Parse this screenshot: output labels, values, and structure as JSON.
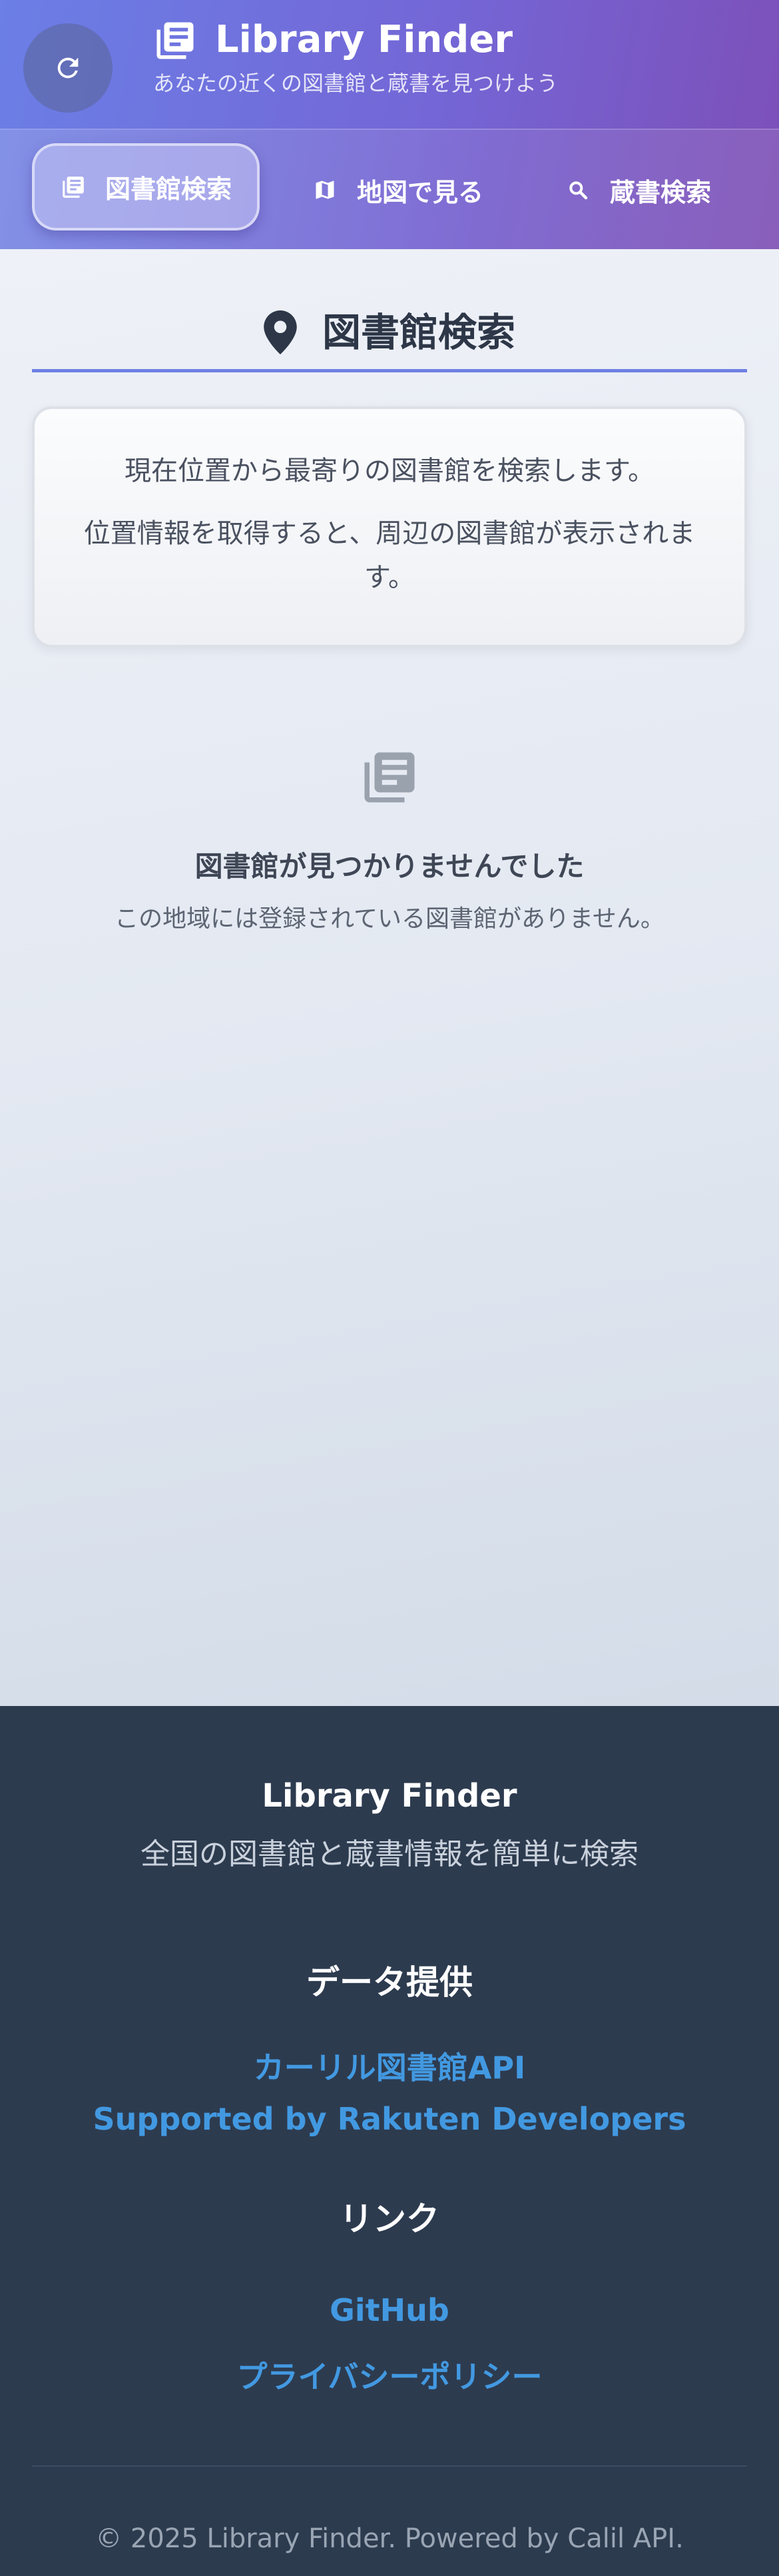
{
  "header": {
    "title": "Library Finder",
    "subtitle": "あなたの近くの図書館と蔵書を見つけよう",
    "refresh_icon": "refresh-icon",
    "brand_icon": "library-books-icon",
    "gradient_colors": [
      "#6b7fe6",
      "#7466d6",
      "#7d4fb8"
    ]
  },
  "nav": {
    "tabs": [
      {
        "label": "図書館検索",
        "icon": "library-books-icon",
        "active": true
      },
      {
        "label": "地図で見る",
        "icon": "map-icon",
        "active": false
      },
      {
        "label": "蔵書検索",
        "icon": "search-icon",
        "active": false
      }
    ]
  },
  "main": {
    "section_title": "図書館検索",
    "section_icon": "location-pin-icon",
    "accent_color": "#6f80e4",
    "info": {
      "line1": "現在位置から最寄りの図書館を検索します。",
      "line2": "位置情報を取得すると、周辺の図書館が表示されます。"
    },
    "empty_state": {
      "icon": "library-books-icon",
      "title": "図書館が見つかりませんでした",
      "description": "この地域には登録されている図書館がありません。"
    }
  },
  "footer": {
    "title": "Library Finder",
    "description": "全国の図書館と蔵書情報を簡単に検索",
    "data_heading": "データ提供",
    "data_links": [
      "カーリル図書館API",
      "Supported by Rakuten Developers"
    ],
    "links_heading": "リンク",
    "links": [
      "GitHub",
      "プライバシーポリシー"
    ],
    "copyright": "© 2025 Library Finder. Powered by Calil API.",
    "link_color": "#4299e1",
    "background_color": "#2d3b4f"
  }
}
